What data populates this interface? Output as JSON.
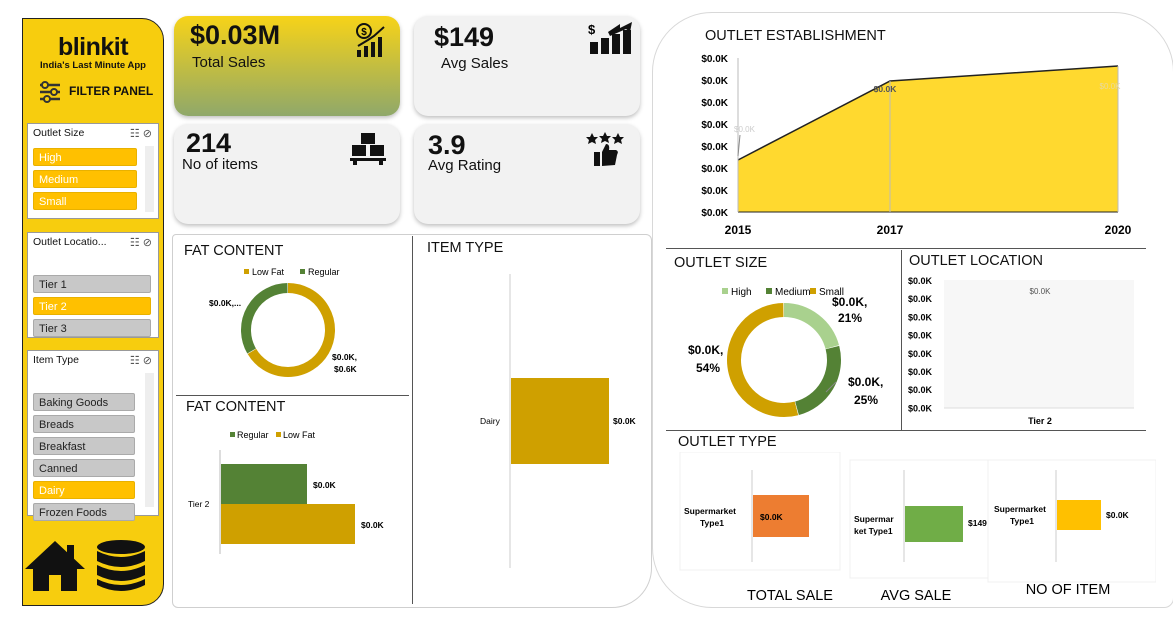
{
  "brand": {
    "name": "blinkit",
    "tagline": "India's Last Minute App",
    "filter_panel": "FILTER PANEL"
  },
  "filters": {
    "outlet_size": {
      "title": "Outlet Size",
      "items": [
        {
          "label": "High",
          "selected": true
        },
        {
          "label": "Medium",
          "selected": true
        },
        {
          "label": "Small",
          "selected": true
        }
      ]
    },
    "outlet_location": {
      "title": "Outlet Locatio...",
      "items": [
        {
          "label": "Tier 1",
          "selected": false
        },
        {
          "label": "Tier 2",
          "selected": true
        },
        {
          "label": "Tier 3",
          "selected": false
        }
      ]
    },
    "item_type": {
      "title": "Item Type",
      "items": [
        {
          "label": "Baking Goods",
          "selected": false
        },
        {
          "label": "Breads",
          "selected": false
        },
        {
          "label": "Breakfast",
          "selected": false
        },
        {
          "label": "Canned",
          "selected": false
        },
        {
          "label": "Dairy",
          "selected": true
        },
        {
          "label": "Frozen Foods",
          "selected": false
        }
      ]
    }
  },
  "kpis": {
    "total_sales": {
      "value": "$0.03M",
      "label": "Total Sales"
    },
    "avg_sales": {
      "value": "$149",
      "label": "Avg Sales"
    },
    "no_of_items": {
      "value": "214",
      "label": "No of items"
    },
    "avg_rating": {
      "value": "3.9",
      "label": "Avg Rating"
    }
  },
  "colors": {
    "yellow": "#ffd92f",
    "gold": "#cfa000",
    "green": "#548235",
    "lightgreen": "#a9d18e",
    "orange": "#ed7d31",
    "midgreen": "#70ad47",
    "amber": "#ffc000",
    "sidebar": "#f7cd0e"
  },
  "chart_data": [
    {
      "id": "fat_donut",
      "type": "pie",
      "title": "FAT CONTENT",
      "legend": [
        "Low Fat",
        "Regular"
      ],
      "categories": [
        "Low Fat",
        "Regular"
      ],
      "values": [
        0.6,
        0.3
      ],
      "labels": [
        "$0.0K, $0.6K",
        "$0.0K,..."
      ]
    },
    {
      "id": "fat_bar",
      "type": "bar",
      "title": "FAT CONTENT",
      "legend": [
        "Regular",
        "Low Fat"
      ],
      "categories": [
        "Tier 2"
      ],
      "series": [
        {
          "name": "Regular",
          "values": [
            0.0
          ],
          "label": "$0.0K"
        },
        {
          "name": "Low Fat",
          "values": [
            0.0
          ],
          "label": "$0.0K"
        }
      ]
    },
    {
      "id": "item_type",
      "type": "bar",
      "title": "ITEM TYPE",
      "categories": [
        "Dairy"
      ],
      "values": [
        0.0
      ],
      "labels": [
        "$0.0K"
      ]
    },
    {
      "id": "establishment",
      "type": "area",
      "title": "OUTLET ESTABLISHMENT",
      "x": [
        "2015",
        "2017",
        "2020"
      ],
      "values": [
        0.0,
        0.0,
        0.0
      ],
      "point_labels": [
        "$0.0K",
        "$0.0K",
        "$0.0K"
      ],
      "y_ticks": [
        "$0.0K",
        "$0.0K",
        "$0.0K",
        "$0.0K",
        "$0.0K",
        "$0.0K",
        "$0.0K",
        "$0.0K"
      ]
    },
    {
      "id": "outlet_size",
      "type": "pie",
      "title": "OUTLET SIZE",
      "legend": [
        "High",
        "Medium",
        "Small"
      ],
      "categories": [
        "High",
        "Medium",
        "Small"
      ],
      "values": [
        21,
        25,
        54
      ],
      "labels": [
        "$0.0K, 21%",
        "$0.0K, 25%",
        "$0.0K, 54%"
      ]
    },
    {
      "id": "outlet_location",
      "type": "bar",
      "title": "OUTLET LOCATION",
      "categories": [
        "Tier 2"
      ],
      "values": [
        0.0
      ],
      "point_label": "$0.0K",
      "y_ticks": [
        "$0.0K",
        "$0.0K",
        "$0.0K",
        "$0.0K",
        "$0.0K",
        "$0.0K",
        "$0.0K",
        "$0.0K"
      ]
    },
    {
      "id": "outlet_type",
      "title": "OUTLET TYPE",
      "charts": [
        {
          "type": "bar",
          "caption": "TOTAL SALE",
          "category": "Supermarket Type1",
          "label": "$0.0K",
          "color": "#ed7d31"
        },
        {
          "type": "bar",
          "caption": "AVG SALE",
          "category": "Supermar ket Type1",
          "label": "$149",
          "color": "#70ad47"
        },
        {
          "type": "bar",
          "caption": "NO OF ITEM",
          "category": "Supermarket Type1",
          "label": "$0.0K",
          "color": "#ffc000"
        }
      ]
    }
  ]
}
